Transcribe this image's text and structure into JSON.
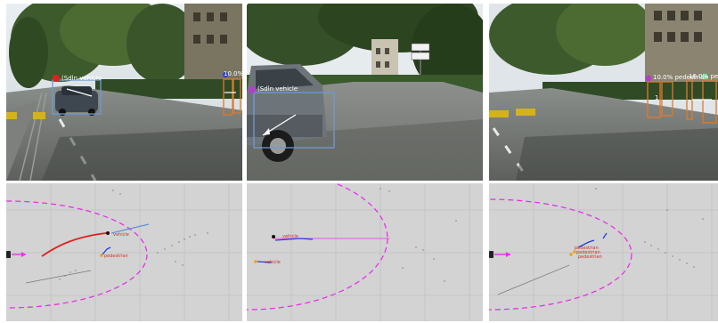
{
  "panels": [
    {
      "camera": {
        "detections": [
          {
            "label": "(Sdln vehicle",
            "color": "#6f9ad6"
          },
          {
            "label": "10.0% pedestrian",
            "color": "#e07a28"
          }
        ]
      },
      "map": {
        "labels": [
          "pedestrian",
          "vehicle"
        ]
      }
    },
    {
      "camera": {
        "detections": [
          {
            "label": "(Sdln vehicle",
            "color": "#6f9ad6"
          }
        ]
      },
      "map": {
        "labels": [
          "vehicle",
          "vehicle"
        ]
      }
    },
    {
      "camera": {
        "detections": [
          {
            "label": "10.0% pedestrian",
            "color": "#e07a28"
          },
          {
            "label": "10.0% pedestrian",
            "color": "#e07a28"
          },
          {
            "label": "1",
            "color": "#ffffff"
          }
        ]
      },
      "map": {
        "labels": [
          "pedestrian",
          "pedestrian",
          "pedestrian"
        ]
      }
    }
  ],
  "colors": {
    "range_ellipse": "#e830e8",
    "ego_arrow": "#e830e8",
    "trajectory": "#e02020",
    "vehicle_box": "#6f9ad6",
    "pedestrian_box": "#e07a28",
    "track_blue": "#1f3fd8",
    "map_background": "#d3d3d3",
    "grid": "#c2c2c2"
  },
  "icons": [
    "ego-vehicle-icon",
    "ego-direction-arrow-icon",
    "track-velocity-arrow-icon"
  ]
}
